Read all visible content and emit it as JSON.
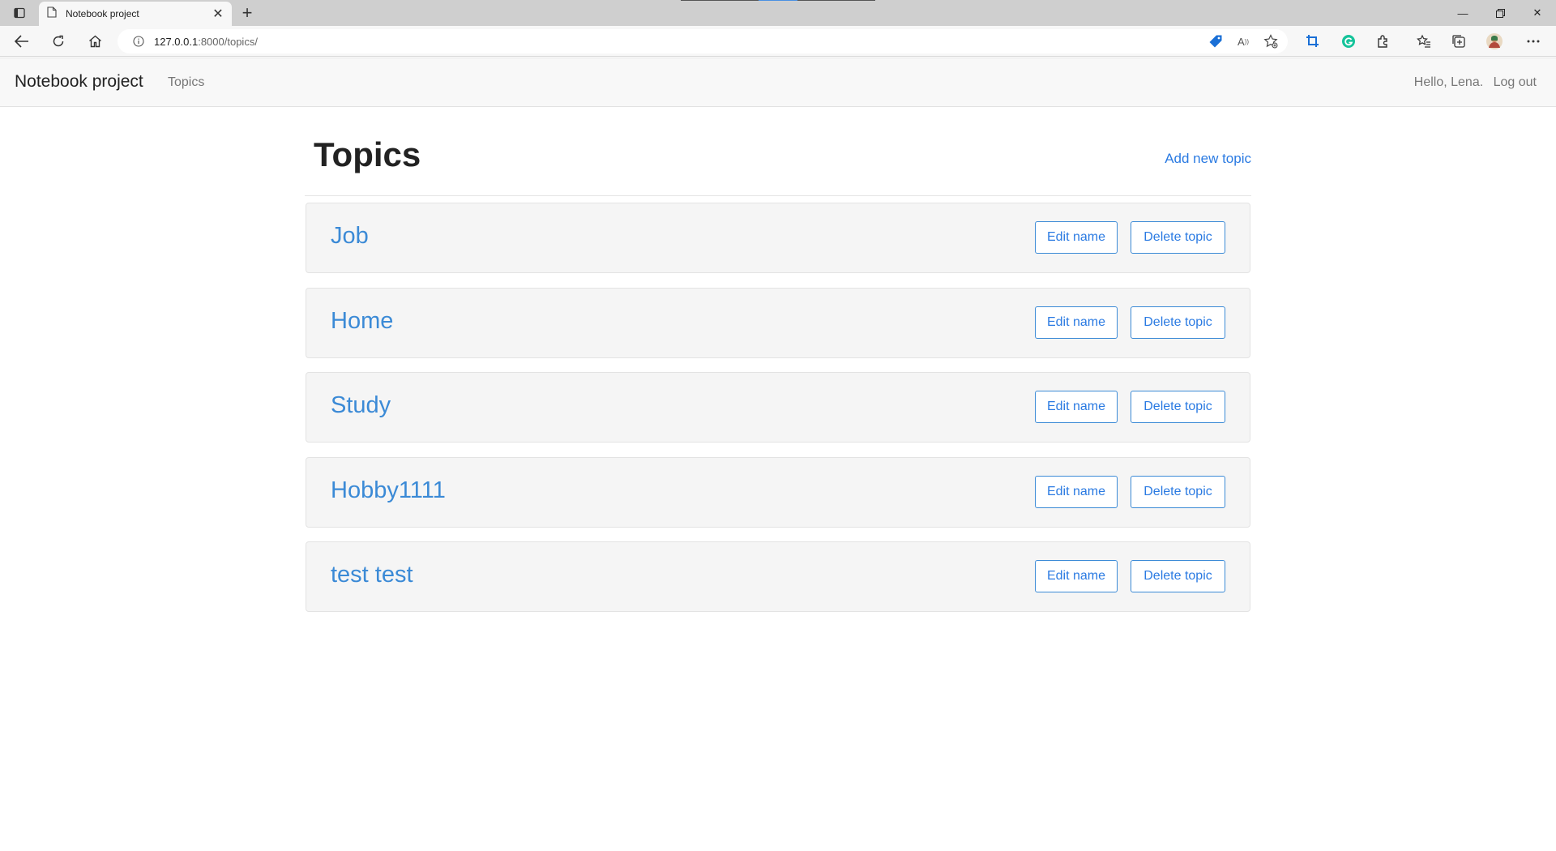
{
  "browser": {
    "tab_title": "Notebook project",
    "url_host": "127.0.0.1",
    "url_rest": ":8000/topics/"
  },
  "navbar": {
    "brand": "Notebook project",
    "topics_link": "Topics",
    "greeting": "Hello, Lena.",
    "logout": "Log out"
  },
  "page": {
    "title": "Topics",
    "add_link": "Add new topic"
  },
  "topics": [
    {
      "name": "Job",
      "edit_label": "Edit name",
      "delete_label": "Delete topic"
    },
    {
      "name": "Home",
      "edit_label": "Edit name",
      "delete_label": "Delete topic"
    },
    {
      "name": "Study",
      "edit_label": "Edit name",
      "delete_label": "Delete topic"
    },
    {
      "name": "Hobby1111",
      "edit_label": "Edit name",
      "delete_label": "Delete topic"
    },
    {
      "name": "test test",
      "edit_label": "Edit name",
      "delete_label": "Delete topic"
    }
  ],
  "colors": {
    "accent": "#2a7ae2",
    "card_bg": "#f5f5f5",
    "navbar_bg": "#f8f8f8"
  },
  "icons": [
    "sidebar-toggle-icon",
    "page-icon",
    "close-icon",
    "plus-icon",
    "back-icon",
    "refresh-icon",
    "home-icon",
    "info-icon",
    "tag-icon",
    "read-aloud-icon",
    "favorite-add-icon",
    "crop-icon",
    "grammarly-icon",
    "extensions-icon",
    "favorites-icon",
    "collections-icon",
    "avatar",
    "more-icon"
  ]
}
